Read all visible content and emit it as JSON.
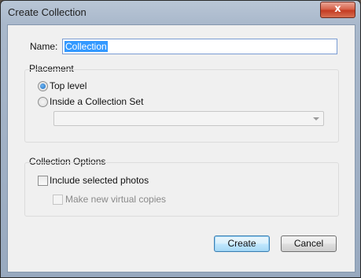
{
  "window": {
    "title": "Create Collection",
    "close_glyph": "x"
  },
  "name": {
    "label": "Name:",
    "value": "Collection"
  },
  "placement": {
    "legend": "Placement",
    "options": [
      {
        "label": "Top level",
        "checked": true
      },
      {
        "label": "Inside a Collection Set",
        "checked": false
      }
    ],
    "collection_set_value": ""
  },
  "collection_options": {
    "legend": "Collection Options",
    "include_selected_photos": {
      "label": "Include selected photos",
      "checked": false
    },
    "make_virtual_copies": {
      "label": "Make new virtual copies",
      "checked": false,
      "disabled": true
    }
  },
  "buttons": {
    "create": "Create",
    "cancel": "Cancel"
  },
  "colors": {
    "accent": "#3399ff",
    "close": "#c43b22"
  }
}
